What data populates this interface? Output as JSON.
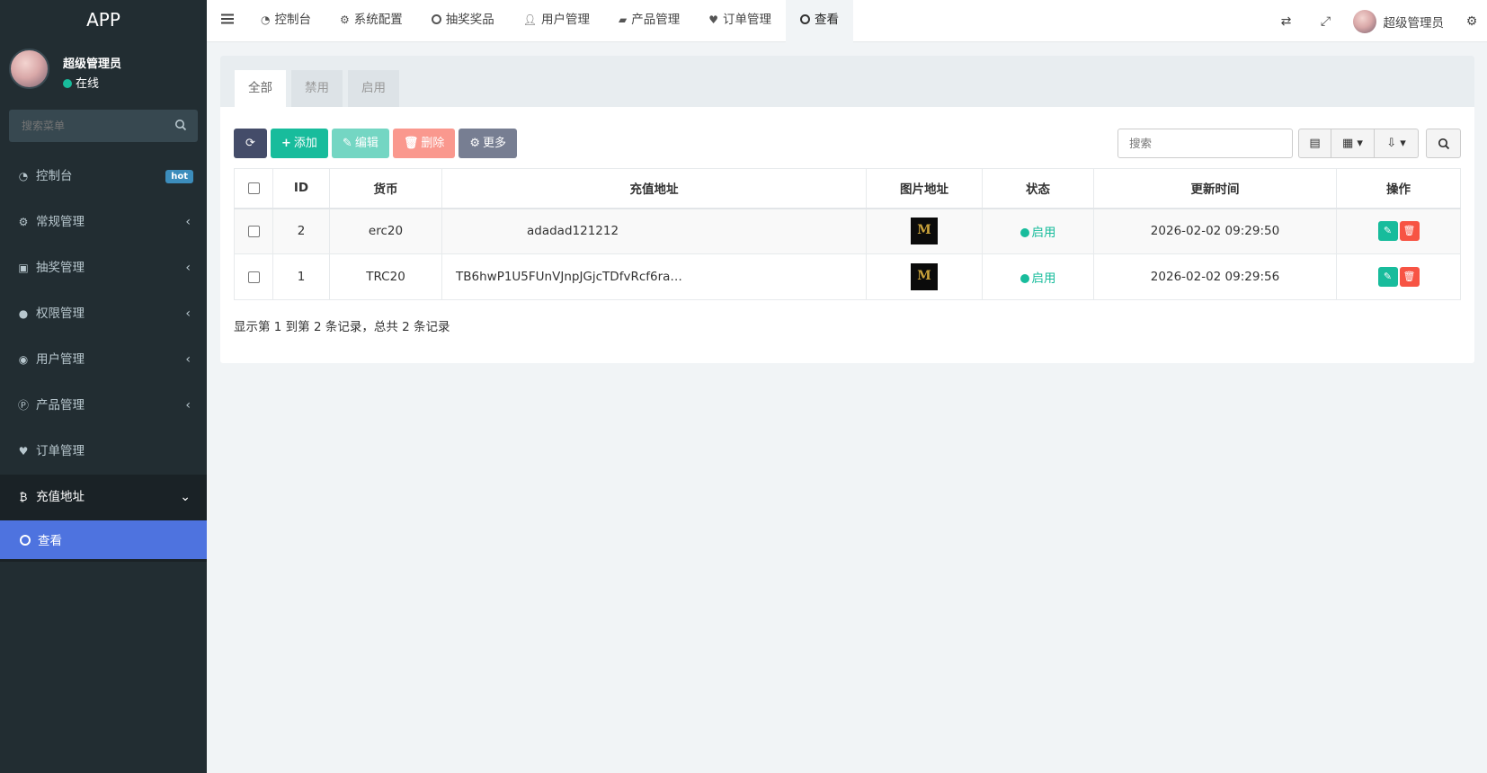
{
  "app": {
    "title": "APP"
  },
  "user": {
    "name": "超级管理员",
    "status": "在线"
  },
  "sidebar": {
    "search_placeholder": "搜索菜单",
    "items": [
      {
        "label": "控制台",
        "icon": "dashboard-icon",
        "badge": "hot"
      },
      {
        "label": "常规管理",
        "icon": "cogs-icon"
      },
      {
        "label": "抽奖管理",
        "icon": "gift-icon"
      },
      {
        "label": "权限管理",
        "icon": "group-icon"
      },
      {
        "label": "用户管理",
        "icon": "user-circle-icon"
      },
      {
        "label": "产品管理",
        "icon": "product-icon"
      },
      {
        "label": "订单管理",
        "icon": "heartbeat-icon"
      },
      {
        "label": "充值地址",
        "icon": "bitcoin-icon"
      }
    ],
    "sub_item": "查看"
  },
  "topnav": {
    "tabs": [
      {
        "label": "控制台",
        "icon": "dashboard-icon"
      },
      {
        "label": "系统配置",
        "icon": "gear-icon"
      },
      {
        "label": "抽奖奖品",
        "icon": "circle-icon"
      },
      {
        "label": "用户管理",
        "icon": "user-icon"
      },
      {
        "label": "产品管理",
        "icon": "shopping-bag-icon"
      },
      {
        "label": "订单管理",
        "icon": "heartbeat-icon"
      },
      {
        "label": "查看",
        "icon": "circle-icon"
      }
    ],
    "username": "超级管理员"
  },
  "panel": {
    "tabs": [
      "全部",
      "禁用",
      "启用"
    ],
    "toolbar": {
      "add": "添加",
      "edit": "编辑",
      "delete": "删除",
      "more": "更多"
    },
    "search_placeholder": "搜索"
  },
  "table": {
    "headers": [
      "ID",
      "货币",
      "充值地址",
      "图片地址",
      "状态",
      "更新时间",
      "操作"
    ],
    "rows": [
      {
        "id": "2",
        "currency": "erc20",
        "address": "adadad121212",
        "status": "启用",
        "updated": "2026-02-02 09:29:50"
      },
      {
        "id": "1",
        "currency": "TRC20",
        "address": "TB6hwP1U5FUnVJnpJGjcTDfvRcf6ra…",
        "status": "启用",
        "updated": "2026-02-02 09:29:56"
      }
    ],
    "thumb_letter": "M"
  },
  "pagination": {
    "info": "显示第 1 到第 2 条记录，总共 2 条记录"
  },
  "colors": {
    "sidebar": "#222d32",
    "active_sub": "#4e73df",
    "success": "#18bc9c",
    "danger": "#f75444",
    "refresh": "#444c69"
  }
}
